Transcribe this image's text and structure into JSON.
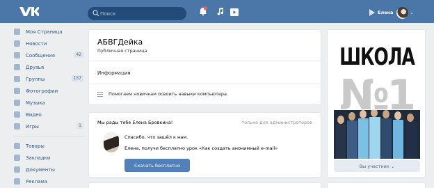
{
  "topbar": {
    "logo_icon": "vk-logo-icon",
    "search_placeholder": "Поиск",
    "user_name": "Елена",
    "accent_color": "#4a76a8"
  },
  "sidebar": {
    "items": [
      {
        "label": "Моя Страница",
        "icon": "home-icon"
      },
      {
        "label": "Новости",
        "icon": "news-icon"
      },
      {
        "label": "Сообщения",
        "icon": "messages-icon",
        "count": "42"
      },
      {
        "label": "Друзья",
        "icon": "friends-icon"
      },
      {
        "label": "Группы",
        "icon": "groups-icon",
        "count": "157"
      },
      {
        "label": "Фотографии",
        "icon": "camera-icon"
      },
      {
        "label": "Музыка",
        "icon": "music-icon"
      },
      {
        "label": "Видео",
        "icon": "video-icon"
      },
      {
        "label": "Игры",
        "icon": "games-icon",
        "count": "1"
      }
    ],
    "items2": [
      {
        "label": "Товары",
        "icon": "bag-icon"
      },
      {
        "label": "Закладки",
        "icon": "star-icon"
      },
      {
        "label": "Документы",
        "icon": "document-icon"
      },
      {
        "label": "Реклама",
        "icon": "ads-icon"
      }
    ]
  },
  "page": {
    "title": "АБВГДейка",
    "subtitle": "Публичная страница",
    "info_label": "Информация",
    "description": "Помогаем новичкам освоить навыки компьютера."
  },
  "post": {
    "welcome": "Мы рады тебе Елена Бровкина!",
    "admin_only": "только для администраторов",
    "thanks": "Спасибо, что зашёл к нам.",
    "lesson": "Елена, получи бесплатно урок «Как создать анонимный e-mail»",
    "button": "Скачать бесплатно"
  },
  "cover": {
    "title": "ШКОЛА",
    "number": "№1",
    "member_button": "Вы участник ⌄"
  }
}
